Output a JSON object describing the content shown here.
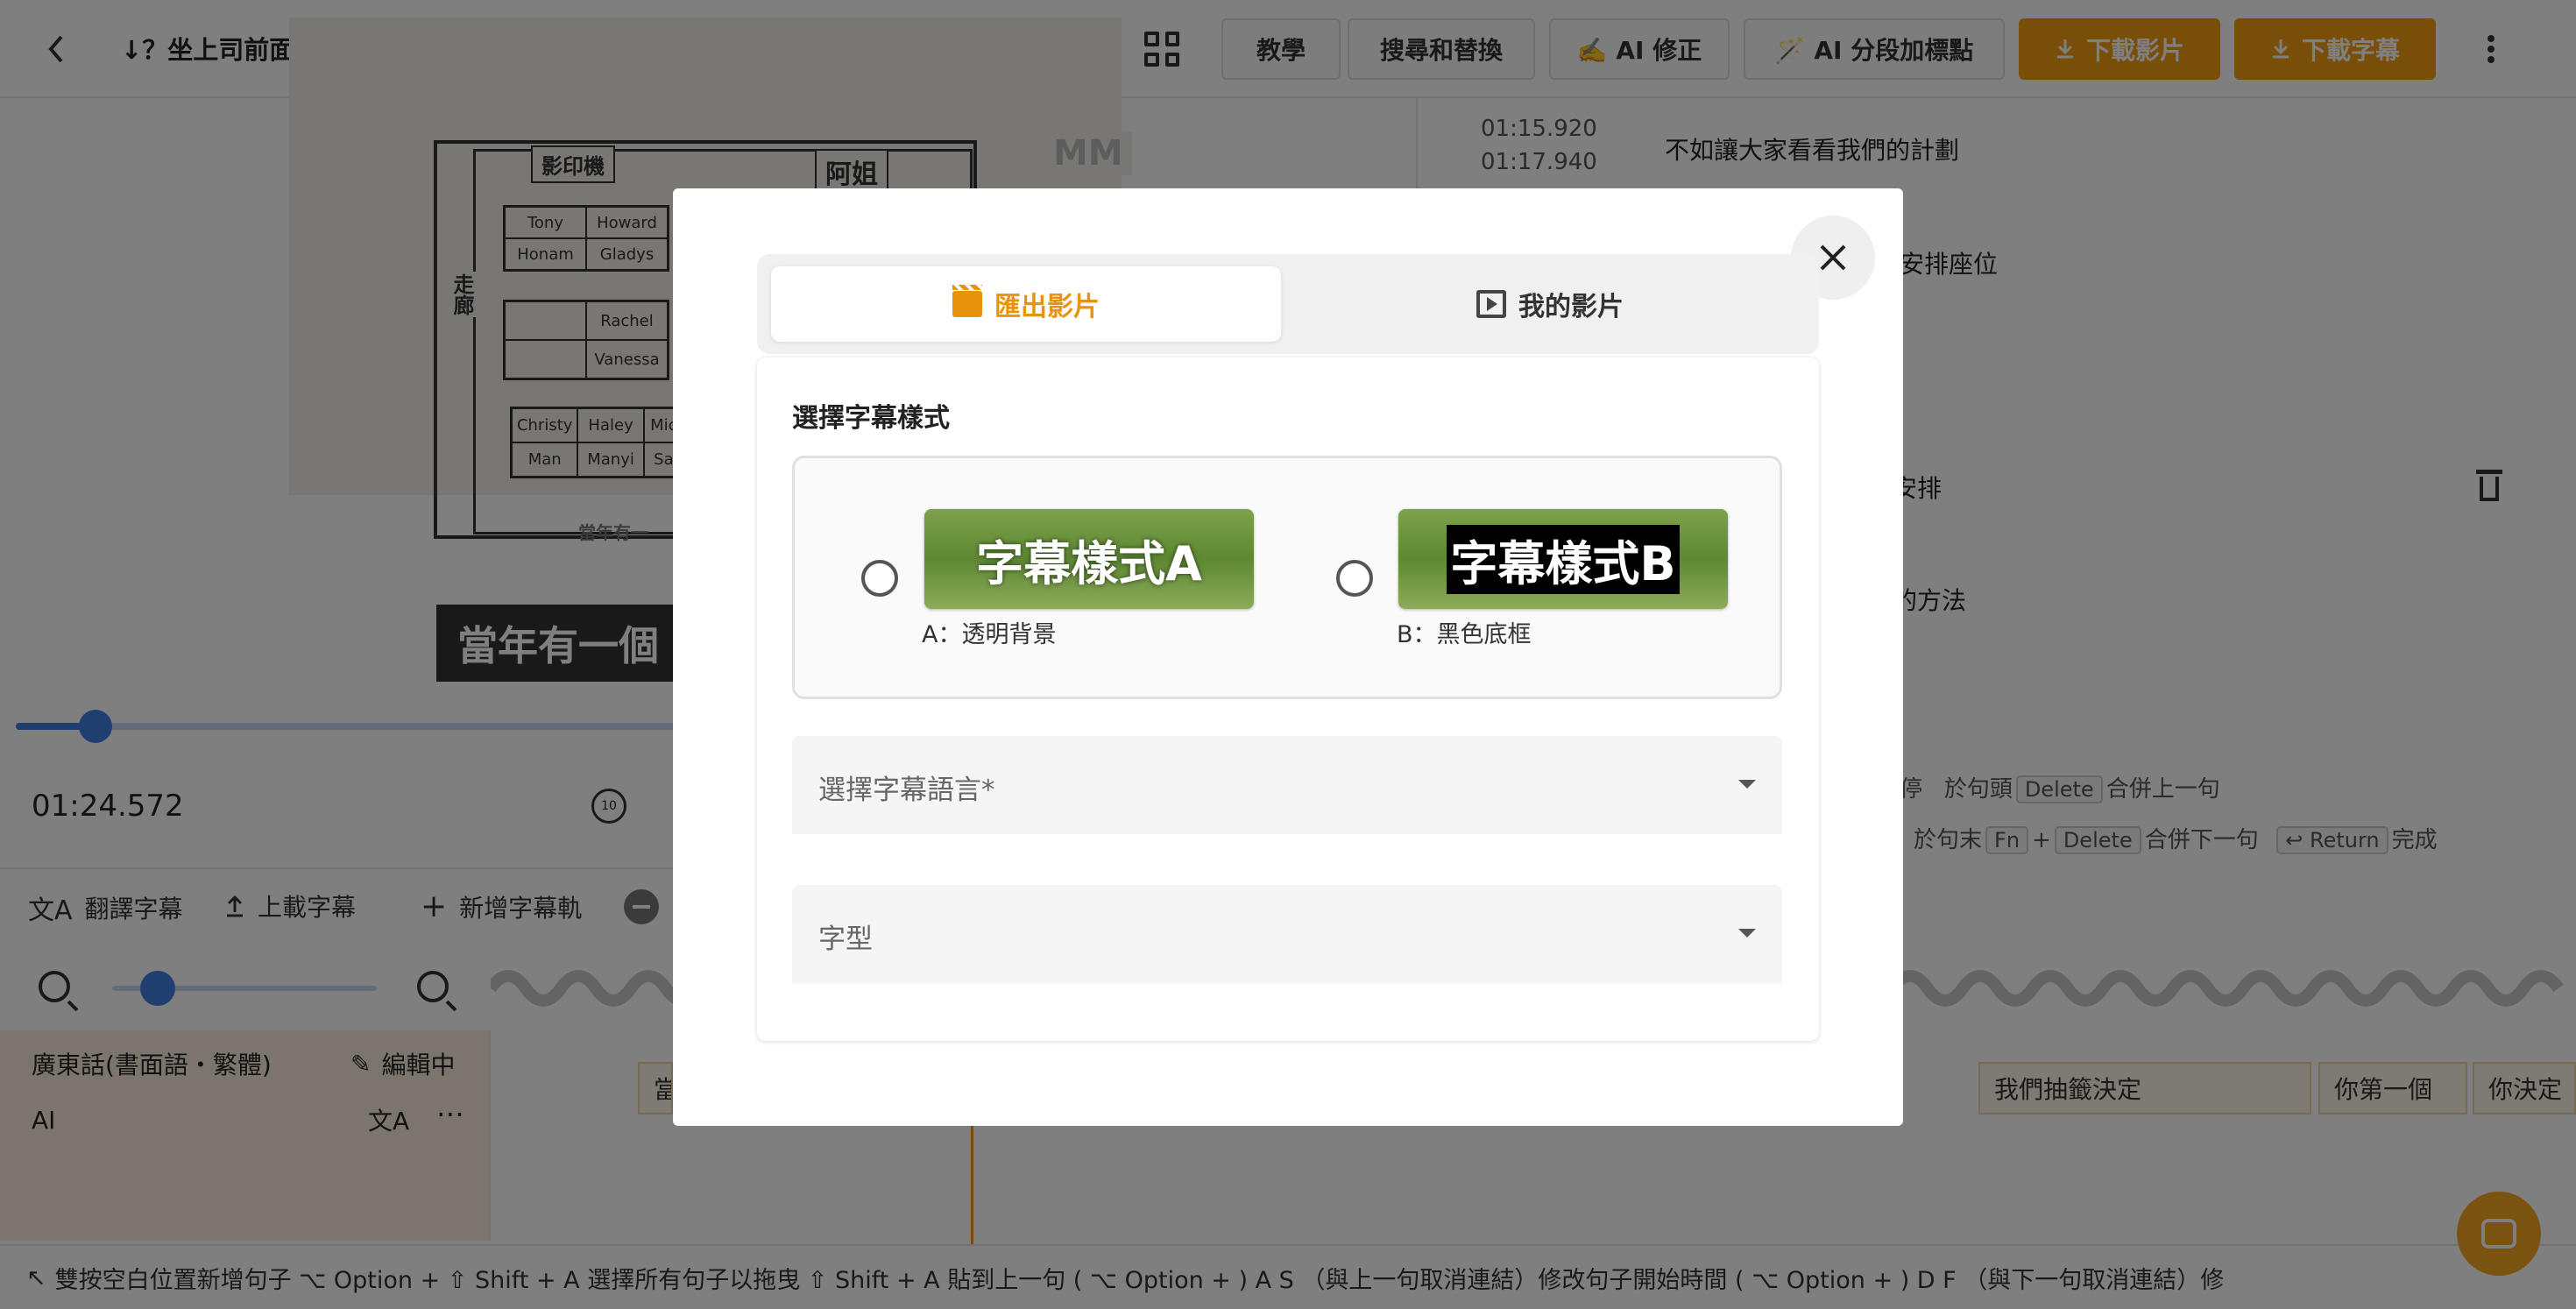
{
  "header": {
    "title": "↓？坐上司前面不危反有機！HR拆解靚仔靚女有特別座位安排 票投最不受歡迎",
    "buttons": {
      "tutorial": "教學",
      "search_replace": "搜尋和替換",
      "ai_correct": "✍️ AI 修正",
      "ai_segment": "🪄 AI 分段加標點",
      "download_video": "下載影片",
      "download_subtitle": "下載字幕"
    }
  },
  "video": {
    "overlay_subtitle": "當年有一個",
    "current_time": "01:24.572",
    "replay_seconds": "10",
    "sketch_labels": {
      "copier": "影印機",
      "sister": "阿姐",
      "corridor": "走廊",
      "watermark": "MM",
      "burned_caption": "當年有一"
    },
    "seat_names": [
      "Tony",
      "Howard",
      "Honam",
      "Gladys",
      "Rachel",
      "Vanessa",
      "Christy",
      "Haley",
      "Mic",
      "Man",
      "Manyi",
      "Sa"
    ]
  },
  "subtitle_list": {
    "rows": [
      {
        "start": "01:15.920",
        "end": "01:17.940",
        "text": "不如讓大家看看我們的計劃"
      },
      {
        "text": "式安排座位"
      },
      {
        "text": "安排"
      },
      {
        "text": "的方法"
      }
    ],
    "shortcuts_line1": {
      "prefix": "停",
      "mid": "於句頭",
      "key": "Delete",
      "suffix": "合併上一句"
    },
    "shortcuts_line2": {
      "mid": "於句末",
      "key1": "Fn",
      "plus": "+",
      "key2": "Delete",
      "suffix": "合併下一句",
      "key3": "↩ Return",
      "done": "完成"
    }
  },
  "toolbar": {
    "translate": "翻譯字幕",
    "upload": "上載字幕",
    "add_track": "新增字幕軌"
  },
  "track": {
    "language": "廣東話(書面語・繁體)",
    "editing": "編輯中",
    "source": "AI",
    "segments": [
      "當",
      "我們抽籤決定",
      "你第一個",
      "你決定"
    ]
  },
  "hint_bar": {
    "text": "雙按空白位置新增句子   ⌥ Option + ⇧ Shift + A 選擇所有句子以拖曳   ⇧ Shift + A 貼到上一句   ( ⌥ Option + ) A S （與上一句取消連結）修改句子開始時間   ( ⌥ Option + ) D F （與下一句取消連結）修"
  },
  "modal": {
    "tabs": {
      "export": "匯出影片",
      "my_videos": "我的影片"
    },
    "section_title": "選擇字幕樣式",
    "styles": [
      {
        "preview": "字幕樣式A",
        "caption": "A：透明背景"
      },
      {
        "preview": "字幕樣式B",
        "caption": "B：黑色底框"
      }
    ],
    "language_select": {
      "label": "選擇字幕語言*"
    },
    "font_select": {
      "label": "字型"
    }
  },
  "colors": {
    "accent": "#f39c12",
    "primary_blue": "#3d7ee0",
    "track_bg": "#f7ebdc"
  }
}
